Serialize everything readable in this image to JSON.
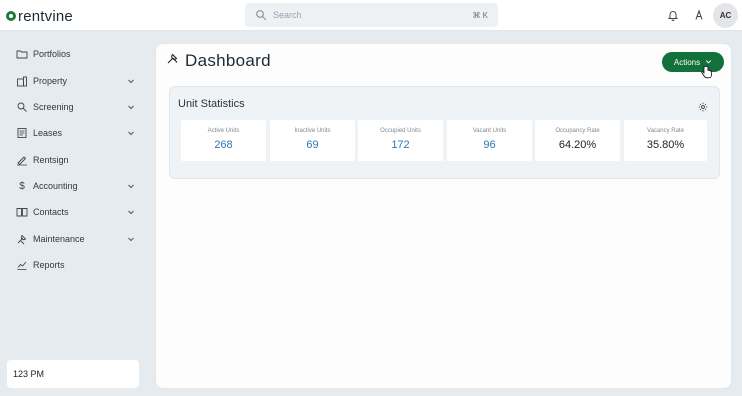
{
  "app": {
    "logo_text": "rentvine"
  },
  "topbar": {
    "search_placeholder": "Search",
    "search_shortcut": "⌘ K",
    "avatar_initials": "AC"
  },
  "sidebar": {
    "items": [
      {
        "label": "Portfolios",
        "icon": "folder-icon",
        "has_chevron": false
      },
      {
        "label": "Property",
        "icon": "building-icon",
        "has_chevron": true
      },
      {
        "label": "Screening",
        "icon": "screening-icon",
        "has_chevron": true
      },
      {
        "label": "Leases",
        "icon": "lease-icon",
        "has_chevron": true
      },
      {
        "label": "Rentsign",
        "icon": "signature-icon",
        "has_chevron": false
      },
      {
        "label": "Accounting",
        "icon": "dollar-icon",
        "has_chevron": true
      },
      {
        "label": "Contacts",
        "icon": "contacts-icon",
        "has_chevron": true
      },
      {
        "label": "Maintenance",
        "icon": "tools-icon",
        "has_chevron": true
      },
      {
        "label": "Reports",
        "icon": "chart-icon",
        "has_chevron": false
      }
    ],
    "time_text": "123 PM"
  },
  "main": {
    "title": "Dashboard",
    "actions_label": "Actions",
    "unit_statistics": {
      "title": "Unit Statistics",
      "stats": [
        {
          "label": "Active Units",
          "value": "268",
          "style": "link"
        },
        {
          "label": "Inactive Units",
          "value": "69",
          "style": "link"
        },
        {
          "label": "Occupied Units",
          "value": "172",
          "style": "link"
        },
        {
          "label": "Vacant Units",
          "value": "96",
          "style": "link"
        },
        {
          "label": "Occupancy Rate",
          "value": "64.20%",
          "style": "plain"
        },
        {
          "label": "Vacancy Rate",
          "value": "35.80%",
          "style": "plain"
        }
      ]
    }
  },
  "colors": {
    "brand_green": "#12713a",
    "link_blue": "#2f78b3",
    "page_bg": "#e6ebef"
  }
}
